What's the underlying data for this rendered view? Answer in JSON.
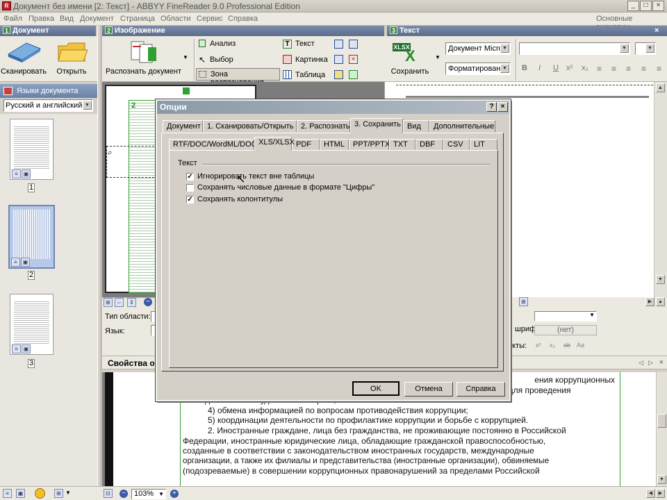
{
  "window": {
    "title": "Документ без имени [2: Текст] - ABBYY FineReader 9.0 Professional Edition",
    "icon_text": "R",
    "minimize": "_",
    "maximize": "□",
    "close": "×"
  },
  "menu": [
    "Файл",
    "Правка",
    "Вид",
    "Документ",
    "Страница",
    "Области",
    "Сервис",
    "Справка"
  ],
  "menu_right": "Основные сценарии",
  "panels": {
    "document": {
      "num": "1",
      "title": "Документ",
      "scan": "Сканировать",
      "open": "Открыть",
      "languages_title": "Языки документа",
      "language": "Русский и английский",
      "pages": [
        "1",
        "2",
        "3"
      ]
    },
    "image": {
      "num": "2",
      "title": "Изображение",
      "recognize": "Распознать документ",
      "tools": [
        "Анализ",
        "Выбор",
        "Зона распознавания"
      ],
      "area_types": [
        "Текст",
        "Картинка",
        "Таблица"
      ],
      "area_type_label": "Тип области:",
      "language_label": "Язык:",
      "properties_label": "Свойства об",
      "zoom": "103%",
      "page_mark": "2"
    },
    "text": {
      "num": "3",
      "title": "Текст",
      "save": "Сохранить",
      "xlsx_badge": "XLSX",
      "format_doc": "Документ Micro",
      "format_mode": "Форматирован",
      "font_label": "шрифта:",
      "font_value": "(нет)",
      "effects_label": "екты:",
      "format_buttons": [
        "B",
        "I",
        "U",
        "x²",
        "x₂"
      ],
      "effect_buttons": [
        "x²",
        "x₂",
        "ab",
        "Aa"
      ]
    }
  },
  "dialog": {
    "title": "Опции",
    "help": "?",
    "close": "×",
    "tabs": [
      "Документ",
      "1. Сканировать/Открыть",
      "2. Распознать",
      "3. Сохранить",
      "Вид",
      "Дополнительные"
    ],
    "active_tab": "3. Сохранить",
    "subtabs": [
      "RTF/DOC/WordML/DOCX",
      "XLS/XLSX",
      "PDF",
      "HTML",
      "PPT/PPTX",
      "TXT",
      "DBF",
      "CSV",
      "LIT"
    ],
    "active_subtab": "XLS/XLSX",
    "group": "Текст",
    "options": [
      {
        "label": "Игнорировать текст вне таблицы",
        "checked": true
      },
      {
        "label": "Сохранять числовые данные в формате \"Цифры\"",
        "checked": false
      },
      {
        "label": "Сохранять колонтитулы",
        "checked": true
      }
    ],
    "check_mark": "✓",
    "ok": "OK",
    "cancel": "Отмена",
    "help_btn": "Справка"
  },
  "doc_text": {
    "line0": "ения коррупционных",
    "line1": "3) предоставления в надлежащих случаях предметов или образцов веществ для проведения",
    "line2": "исследований или судебных экспертиз;",
    "line3": "4) обмена информацией по вопросам противодействия коррупции;",
    "line4": "5) координации деятельности по профилактике коррупции и борьбе с коррупцией.",
    "line5": "2. Иностранные граждане, лица без гражданства, не проживающие постоянно в Российской",
    "line6": "Федерации, иностранные юридические лица, обладающие гражданской правоспособностью,",
    "line7": "созданные в соответствии с законодательством иностранных государств, международные",
    "line8": "организации, а также их филиалы и представительства (иностранные организации), обвиняемые",
    "line9": "(подозреваемые) в совершении коррупционных правонарушений за пределами Российской"
  },
  "colors": {
    "accent_green": "#3c8a3c",
    "panel_head": "#6a7a9a",
    "dialog_title": "#9aa6b2"
  }
}
